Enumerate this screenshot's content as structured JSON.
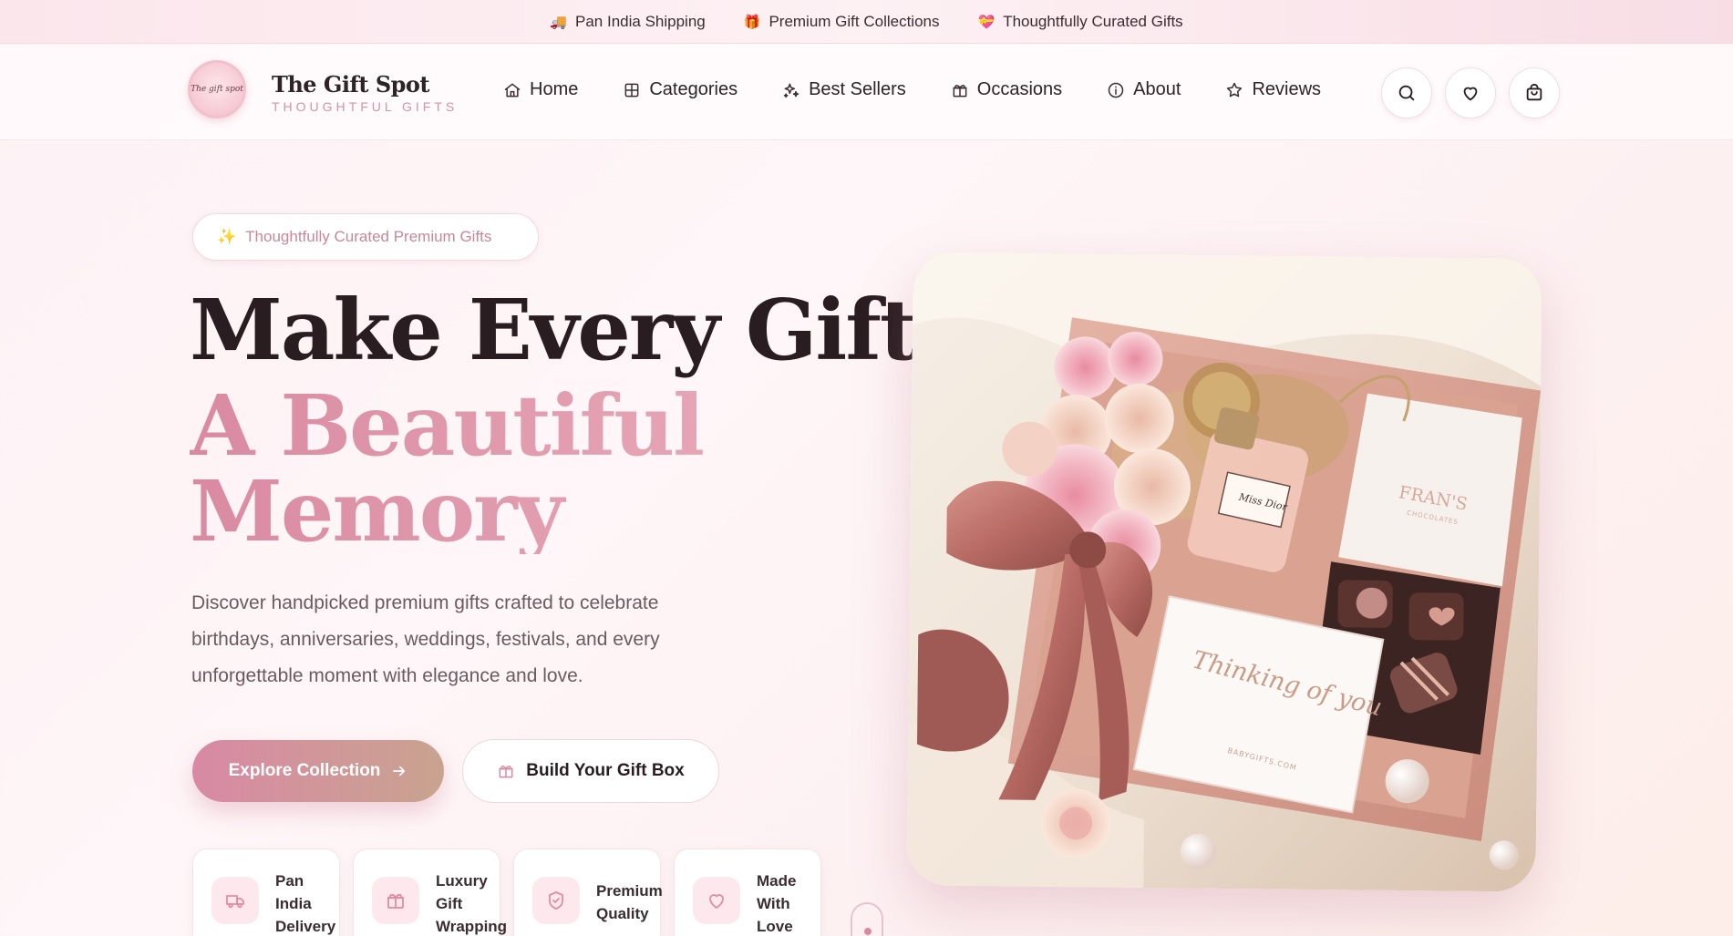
{
  "topbar": {
    "items": [
      {
        "emoji": "🚚",
        "label": "Pan India Shipping"
      },
      {
        "emoji": "🎁",
        "label": "Premium Gift Collections"
      },
      {
        "emoji": "💝",
        "label": "Thoughtfully Curated Gifts"
      }
    ]
  },
  "header": {
    "logo_text": "The gift spot",
    "brand_name": "The Gift Spot",
    "brand_tagline": "THOUGHTFUL GIFTS",
    "nav": [
      {
        "icon": "home-icon",
        "label": "Home"
      },
      {
        "icon": "grid-icon",
        "label": "Categories"
      },
      {
        "icon": "sparkles-icon",
        "label": "Best Sellers"
      },
      {
        "icon": "gift-icon",
        "label": "Occasions"
      },
      {
        "icon": "info-icon",
        "label": "About"
      },
      {
        "icon": "star-icon",
        "label": "Reviews"
      }
    ],
    "actions": [
      "search-icon",
      "heart-icon",
      "bag-icon"
    ]
  },
  "hero": {
    "pill_emoji": "✨",
    "pill_label": "Thoughtfully Curated Premium Gifts",
    "title_line1": "Make Every Gift",
    "title_line2": "A Beautiful Memory",
    "description": "Discover handpicked premium gifts crafted to celebrate birthdays, anniversaries, weddings, festivals, and every unforgettable moment with elegance and love.",
    "primary_cta": "Explore Collection",
    "secondary_cta": "Build Your Gift Box",
    "features": [
      {
        "icon": "truck-icon",
        "label": "Pan India Delivery"
      },
      {
        "icon": "gift-icon",
        "label": "Luxury Gift Wrapping"
      },
      {
        "icon": "shield-icon",
        "label": "Premium Quality"
      },
      {
        "icon": "heart-icon",
        "label": "Made With Love"
      }
    ],
    "image_texts": {
      "perfume": "Miss Dior",
      "chocolate_box": "FRAN'S",
      "chocolate_sub": "CHOCOLATES",
      "card": "Thinking of you",
      "card_small": "BABYGIFTS.COM"
    }
  },
  "colors": {
    "accent_pink": "#d98aa2",
    "accent_gold": "#c9a38f",
    "dark_text": "#2a1d22",
    "muted_text": "#6b5b61"
  }
}
